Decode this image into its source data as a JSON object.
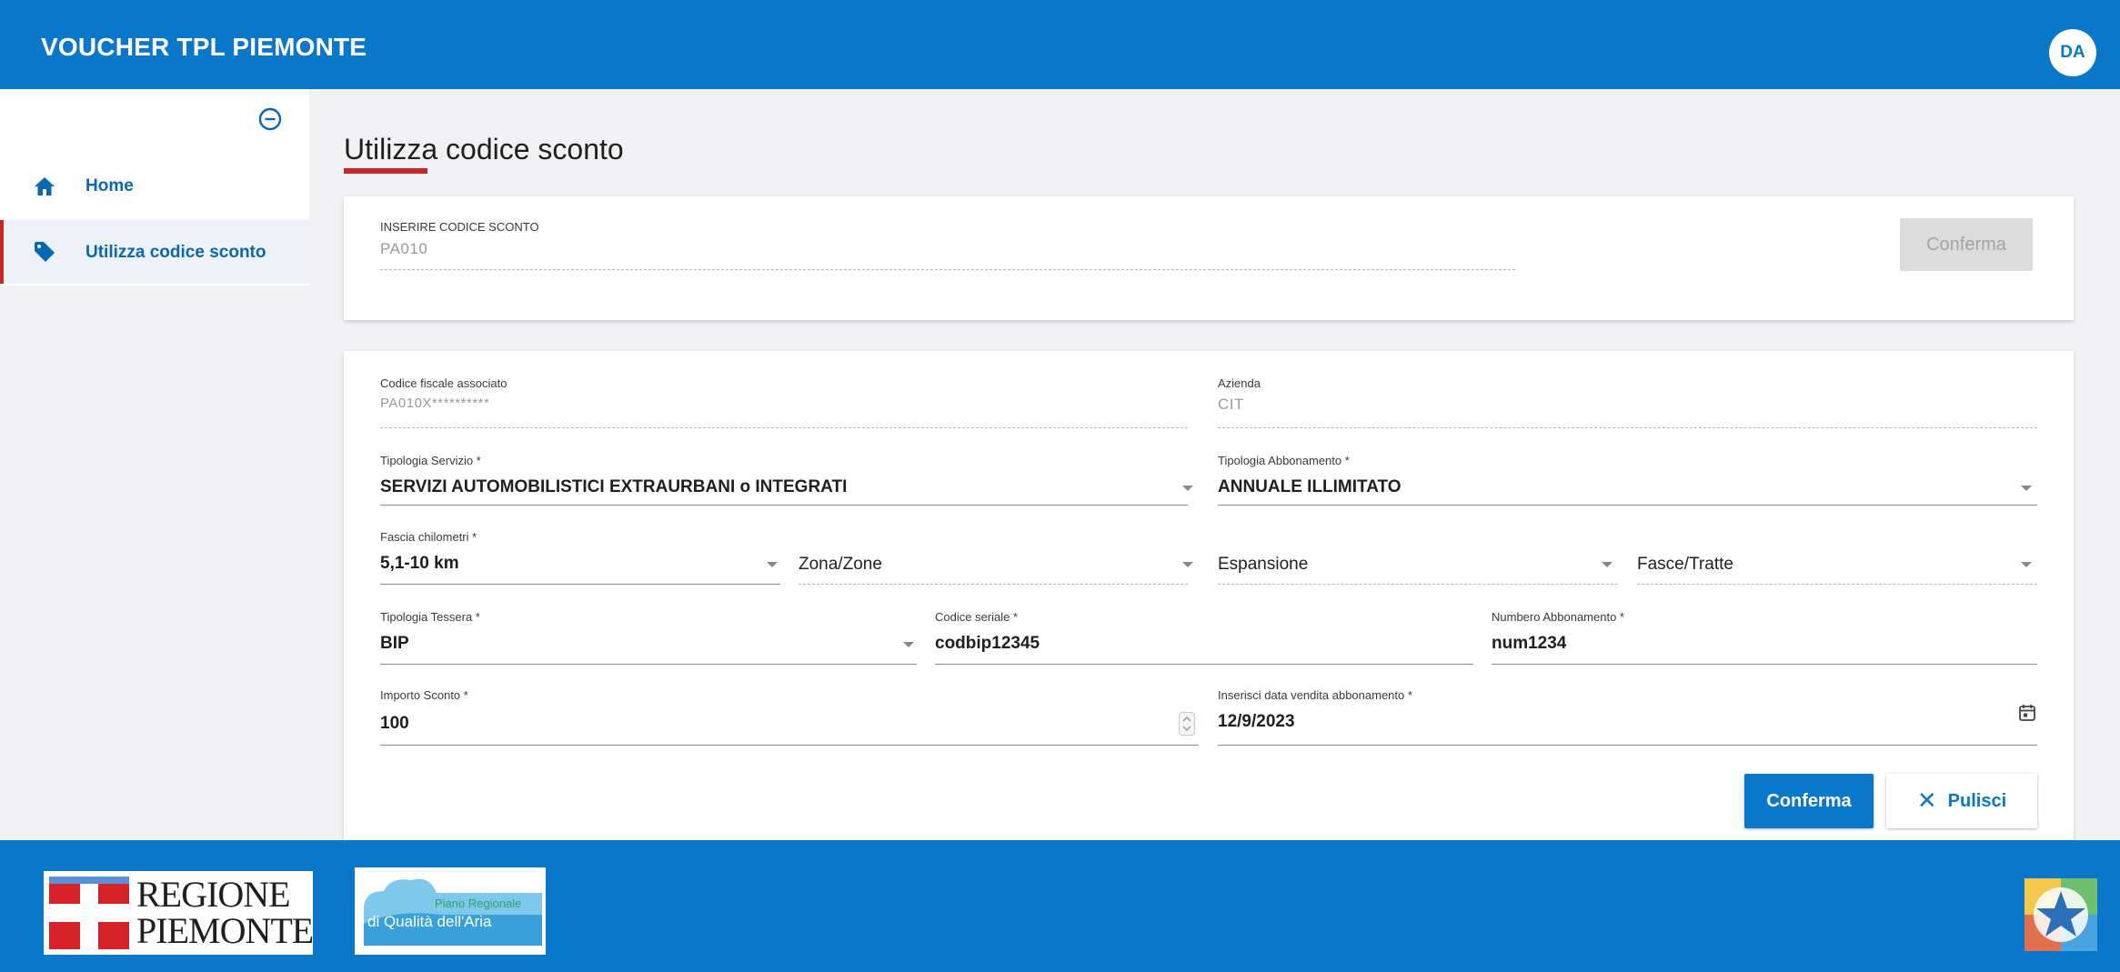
{
  "header": {
    "app_title": "VOUCHER TPL PIEMONTE",
    "avatar_initials": "DA"
  },
  "sidebar": {
    "items": [
      {
        "label": "Home",
        "icon": "home-icon"
      },
      {
        "label": "Utilizza codice sconto",
        "icon": "tag-icon",
        "active": true
      }
    ]
  },
  "page": {
    "title": "Utilizza codice sconto"
  },
  "code_card": {
    "label": "INSERIRE CODICE SCONTO",
    "value": "PA010",
    "confirm_label": "Conferma"
  },
  "form": {
    "codice_fiscale": {
      "label": "Codice fiscale associato",
      "value": "PA010X**********"
    },
    "azienda": {
      "label": "Azienda",
      "value": "CIT"
    },
    "tipologia_servizio": {
      "label": "Tipologia Servizio *",
      "value": "SERVIZI AUTOMOBILISTICI EXTRAURBANI o INTEGRATI"
    },
    "tipologia_abbonamento": {
      "label": "Tipologia Abbonamento *",
      "value": "ANNUALE ILLIMITATO"
    },
    "fascia_chilometri": {
      "label": "Fascia chilometri *",
      "value": "5,1-10 km"
    },
    "zona": {
      "placeholder": "Zona/Zone"
    },
    "espansione": {
      "placeholder": "Espansione"
    },
    "fasce": {
      "placeholder": "Fasce/Tratte"
    },
    "tipologia_tessera": {
      "label": "Tipologia Tessera *",
      "value": "BIP"
    },
    "codice_seriale": {
      "label": "Codice seriale *",
      "value": "codbip12345"
    },
    "numero_abbonamento": {
      "label": "Numbero Abbonamento *",
      "value": "num1234"
    },
    "importo_sconto": {
      "label": "Importo Sconto *",
      "value": "100"
    },
    "data_vendita": {
      "label": "Inserisci data vendita abbonamento *",
      "value": "12/9/2023"
    },
    "confirm_label": "Conferma",
    "clear_label": "Pulisci"
  },
  "footer": {
    "logo_regione_line1": "REGIONE",
    "logo_regione_line2": "PIEMONTE",
    "logo_piano_line1": "Piano Regionale",
    "logo_piano_line2": "di Qualità dell'Aria"
  },
  "colors": {
    "primary": "#0b77c9",
    "accent_red": "#c62828",
    "background": "#f2f2f5"
  }
}
